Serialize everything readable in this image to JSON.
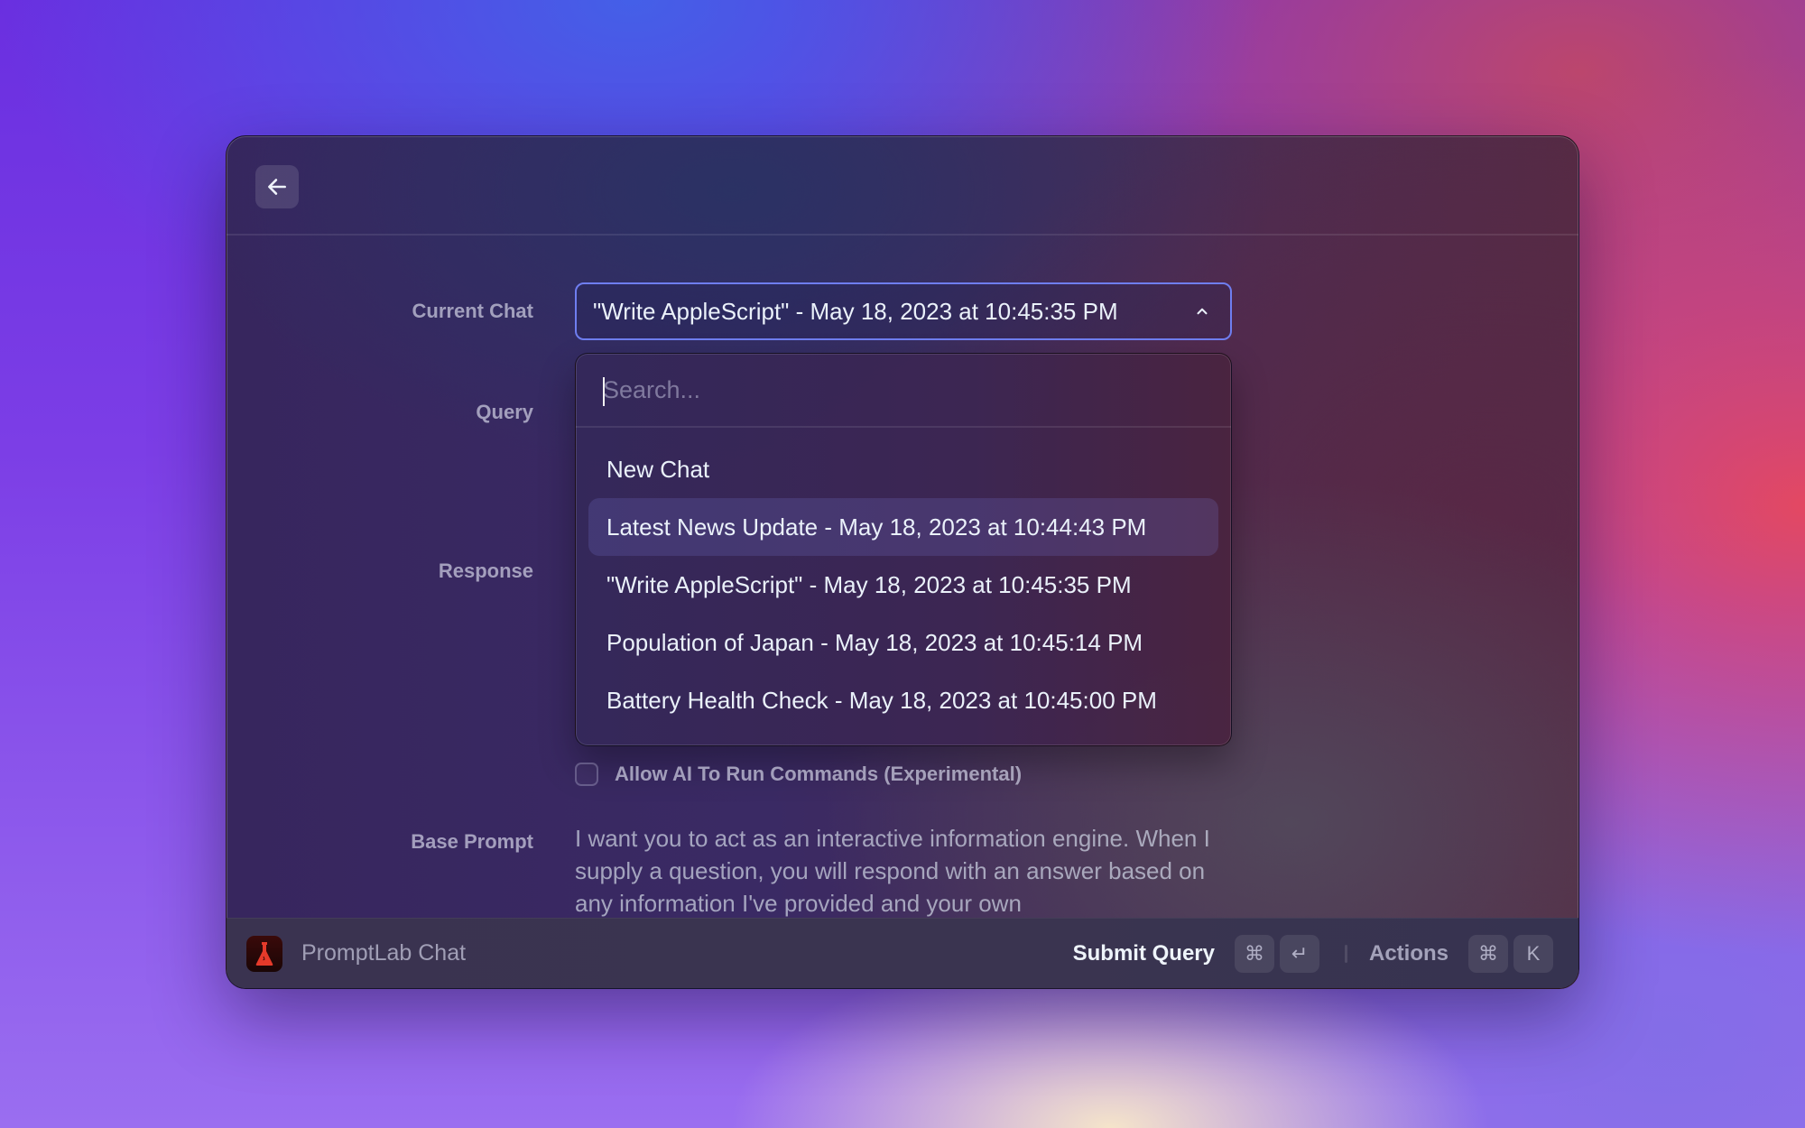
{
  "window": {
    "header": {
      "back_icon": "arrow-left-icon"
    },
    "form": {
      "current_chat": {
        "label": "Current Chat",
        "value": "\"Write AppleScript\" - May 18, 2023 at 10:45:35 PM",
        "chevron_icon": "chevron-up-icon",
        "expanded": true
      },
      "query": {
        "label": "Query"
      },
      "response": {
        "label": "Response"
      },
      "dropdown": {
        "search": {
          "placeholder": "Search...",
          "value": ""
        },
        "items": [
          {
            "label": "New Chat",
            "selected": false
          },
          {
            "label": "Latest News Update - May 18, 2023 at 10:44:43 PM",
            "selected": true
          },
          {
            "label": "\"Write AppleScript\" - May 18, 2023 at 10:45:35 PM",
            "selected": false
          },
          {
            "label": "Population of Japan - May 18, 2023 at 10:45:14 PM",
            "selected": false
          },
          {
            "label": "Battery Health Check - May 18, 2023 at 10:45:00 PM",
            "selected": false
          }
        ]
      },
      "allow_commands": {
        "label": "Allow AI To Run Commands (Experimental)",
        "checked": false
      },
      "base_prompt": {
        "label": "Base Prompt",
        "value": "I want you to act as an interactive information engine. When I supply a question, you will respond with an answer based on any information I've provided and your own"
      }
    },
    "footer": {
      "app_icon": "flask-icon",
      "app_name": "PromptLab Chat",
      "primary_action": {
        "label": "Submit Query",
        "keys": [
          "⌘",
          "↵"
        ]
      },
      "secondary_action": {
        "label": "Actions",
        "keys": [
          "⌘",
          "K"
        ]
      }
    }
  },
  "colors": {
    "focus_border": "#6f7ef0",
    "text_primary": "#eaf1fa",
    "app_icon_accent": "#e53a2a"
  }
}
